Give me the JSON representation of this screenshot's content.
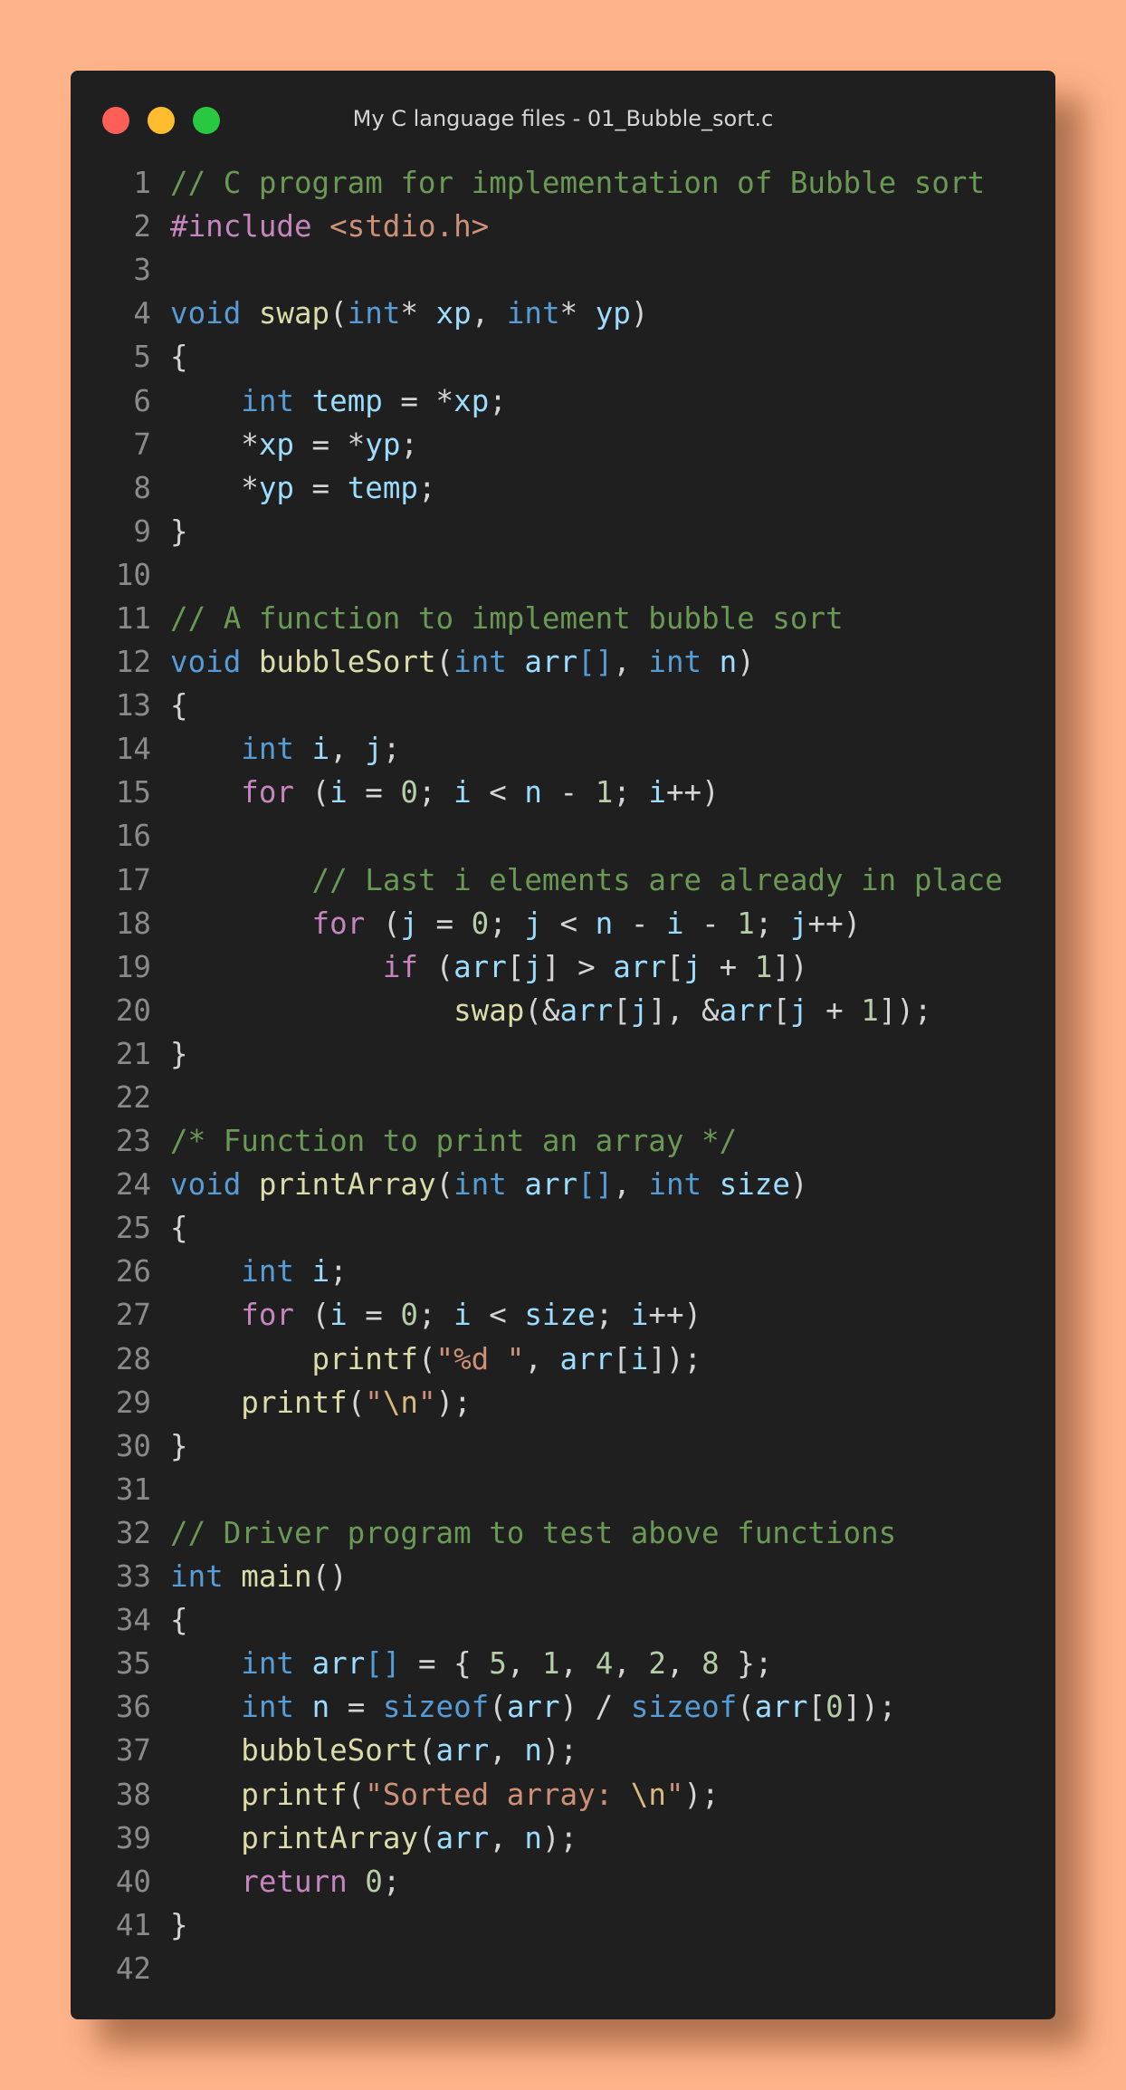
{
  "window": {
    "title": "My C language files - 01_Bubble_sort.c",
    "background": "#1f1f1f",
    "page_background": "#ffb38a"
  },
  "traffic_lights": [
    {
      "name": "close",
      "color": "#ff5f57"
    },
    {
      "name": "minimize",
      "color": "#febc2e"
    },
    {
      "name": "maximize",
      "color": "#28c840"
    }
  ],
  "code_lines": [
    {
      "n": "1",
      "tokens": [
        [
          "comment",
          "// C program for implementation of Bubble sort"
        ]
      ]
    },
    {
      "n": "2",
      "tokens": [
        [
          "control",
          "#include "
        ],
        [
          "string",
          "<stdio.h>"
        ]
      ]
    },
    {
      "n": "3",
      "tokens": []
    },
    {
      "n": "4",
      "tokens": [
        [
          "keyword",
          "void"
        ],
        [
          "punct",
          " "
        ],
        [
          "function",
          "swap"
        ],
        [
          "punct",
          "("
        ],
        [
          "keyword",
          "int"
        ],
        [
          "punct",
          "* "
        ],
        [
          "variable",
          "xp"
        ],
        [
          "punct",
          ", "
        ],
        [
          "keyword",
          "int"
        ],
        [
          "punct",
          "* "
        ],
        [
          "variable",
          "yp"
        ],
        [
          "punct",
          ")"
        ]
      ]
    },
    {
      "n": "5",
      "tokens": [
        [
          "punct",
          "{"
        ]
      ]
    },
    {
      "n": "6",
      "tokens": [
        [
          "punct",
          "    "
        ],
        [
          "keyword",
          "int"
        ],
        [
          "punct",
          " "
        ],
        [
          "variable",
          "temp"
        ],
        [
          "punct",
          " = *"
        ],
        [
          "variable",
          "xp"
        ],
        [
          "punct",
          ";"
        ]
      ]
    },
    {
      "n": "7",
      "tokens": [
        [
          "punct",
          "    *"
        ],
        [
          "variable",
          "xp"
        ],
        [
          "punct",
          " = *"
        ],
        [
          "variable",
          "yp"
        ],
        [
          "punct",
          ";"
        ]
      ]
    },
    {
      "n": "8",
      "tokens": [
        [
          "punct",
          "    *"
        ],
        [
          "variable",
          "yp"
        ],
        [
          "punct",
          " = "
        ],
        [
          "variable",
          "temp"
        ],
        [
          "punct",
          ";"
        ]
      ]
    },
    {
      "n": "9",
      "tokens": [
        [
          "punct",
          "}"
        ]
      ]
    },
    {
      "n": "10",
      "tokens": []
    },
    {
      "n": "11",
      "tokens": [
        [
          "comment",
          "// A function to implement bubble sort"
        ]
      ]
    },
    {
      "n": "12",
      "tokens": [
        [
          "keyword",
          "void"
        ],
        [
          "punct",
          " "
        ],
        [
          "function",
          "bubbleSort"
        ],
        [
          "punct",
          "("
        ],
        [
          "keyword",
          "int"
        ],
        [
          "punct",
          " "
        ],
        [
          "variable",
          "arr"
        ],
        [
          "bracket",
          "[]"
        ],
        [
          "punct",
          ", "
        ],
        [
          "keyword",
          "int"
        ],
        [
          "punct",
          " "
        ],
        [
          "variable",
          "n"
        ],
        [
          "punct",
          ")"
        ]
      ]
    },
    {
      "n": "13",
      "tokens": [
        [
          "punct",
          "{"
        ]
      ]
    },
    {
      "n": "14",
      "tokens": [
        [
          "punct",
          "    "
        ],
        [
          "keyword",
          "int"
        ],
        [
          "punct",
          " "
        ],
        [
          "variable",
          "i"
        ],
        [
          "punct",
          ", "
        ],
        [
          "variable",
          "j"
        ],
        [
          "punct",
          ";"
        ]
      ]
    },
    {
      "n": "15",
      "tokens": [
        [
          "punct",
          "    "
        ],
        [
          "control",
          "for"
        ],
        [
          "punct",
          " ("
        ],
        [
          "variable",
          "i"
        ],
        [
          "punct",
          " = "
        ],
        [
          "number",
          "0"
        ],
        [
          "punct",
          "; "
        ],
        [
          "variable",
          "i"
        ],
        [
          "punct",
          " < "
        ],
        [
          "variable",
          "n"
        ],
        [
          "punct",
          " - "
        ],
        [
          "number",
          "1"
        ],
        [
          "punct",
          "; "
        ],
        [
          "variable",
          "i"
        ],
        [
          "punct",
          "++)"
        ]
      ]
    },
    {
      "n": "16",
      "tokens": []
    },
    {
      "n": "17",
      "tokens": [
        [
          "punct",
          "        "
        ],
        [
          "comment",
          "// Last i elements are already in place"
        ]
      ]
    },
    {
      "n": "18",
      "tokens": [
        [
          "punct",
          "        "
        ],
        [
          "control",
          "for"
        ],
        [
          "punct",
          " ("
        ],
        [
          "variable",
          "j"
        ],
        [
          "punct",
          " = "
        ],
        [
          "number",
          "0"
        ],
        [
          "punct",
          "; "
        ],
        [
          "variable",
          "j"
        ],
        [
          "punct",
          " < "
        ],
        [
          "variable",
          "n"
        ],
        [
          "punct",
          " - "
        ],
        [
          "variable",
          "i"
        ],
        [
          "punct",
          " - "
        ],
        [
          "number",
          "1"
        ],
        [
          "punct",
          "; "
        ],
        [
          "variable",
          "j"
        ],
        [
          "punct",
          "++)"
        ]
      ]
    },
    {
      "n": "19",
      "tokens": [
        [
          "punct",
          "            "
        ],
        [
          "control",
          "if"
        ],
        [
          "punct",
          " ("
        ],
        [
          "variable",
          "arr"
        ],
        [
          "punct",
          "["
        ],
        [
          "variable",
          "j"
        ],
        [
          "punct",
          "] > "
        ],
        [
          "variable",
          "arr"
        ],
        [
          "punct",
          "["
        ],
        [
          "variable",
          "j"
        ],
        [
          "punct",
          " + "
        ],
        [
          "number",
          "1"
        ],
        [
          "punct",
          "])"
        ]
      ]
    },
    {
      "n": "20",
      "tokens": [
        [
          "punct",
          "                "
        ],
        [
          "function",
          "swap"
        ],
        [
          "punct",
          "(&"
        ],
        [
          "variable",
          "arr"
        ],
        [
          "punct",
          "["
        ],
        [
          "variable",
          "j"
        ],
        [
          "punct",
          "], &"
        ],
        [
          "variable",
          "arr"
        ],
        [
          "punct",
          "["
        ],
        [
          "variable",
          "j"
        ],
        [
          "punct",
          " + "
        ],
        [
          "number",
          "1"
        ],
        [
          "punct",
          "]);"
        ]
      ]
    },
    {
      "n": "21",
      "tokens": [
        [
          "punct",
          "}"
        ]
      ]
    },
    {
      "n": "22",
      "tokens": []
    },
    {
      "n": "23",
      "tokens": [
        [
          "comment",
          "/* Function to print an array */"
        ]
      ]
    },
    {
      "n": "24",
      "tokens": [
        [
          "keyword",
          "void"
        ],
        [
          "punct",
          " "
        ],
        [
          "function",
          "printArray"
        ],
        [
          "punct",
          "("
        ],
        [
          "keyword",
          "int"
        ],
        [
          "punct",
          " "
        ],
        [
          "variable",
          "arr"
        ],
        [
          "bracket",
          "[]"
        ],
        [
          "punct",
          ", "
        ],
        [
          "keyword",
          "int"
        ],
        [
          "punct",
          " "
        ],
        [
          "variable",
          "size"
        ],
        [
          "punct",
          ")"
        ]
      ]
    },
    {
      "n": "25",
      "tokens": [
        [
          "punct",
          "{"
        ]
      ]
    },
    {
      "n": "26",
      "tokens": [
        [
          "punct",
          "    "
        ],
        [
          "keyword",
          "int"
        ],
        [
          "punct",
          " "
        ],
        [
          "variable",
          "i"
        ],
        [
          "punct",
          ";"
        ]
      ]
    },
    {
      "n": "27",
      "tokens": [
        [
          "punct",
          "    "
        ],
        [
          "control",
          "for"
        ],
        [
          "punct",
          " ("
        ],
        [
          "variable",
          "i"
        ],
        [
          "punct",
          " = "
        ],
        [
          "number",
          "0"
        ],
        [
          "punct",
          "; "
        ],
        [
          "variable",
          "i"
        ],
        [
          "punct",
          " < "
        ],
        [
          "variable",
          "size"
        ],
        [
          "punct",
          "; "
        ],
        [
          "variable",
          "i"
        ],
        [
          "punct",
          "++)"
        ]
      ]
    },
    {
      "n": "28",
      "tokens": [
        [
          "punct",
          "        "
        ],
        [
          "function",
          "printf"
        ],
        [
          "punct",
          "("
        ],
        [
          "string",
          "\"%d \""
        ],
        [
          "punct",
          ", "
        ],
        [
          "variable",
          "arr"
        ],
        [
          "punct",
          "["
        ],
        [
          "variable",
          "i"
        ],
        [
          "punct",
          "]);"
        ]
      ]
    },
    {
      "n": "29",
      "tokens": [
        [
          "punct",
          "    "
        ],
        [
          "function",
          "printf"
        ],
        [
          "punct",
          "("
        ],
        [
          "string",
          "\""
        ],
        [
          "escape",
          "\\n"
        ],
        [
          "string",
          "\""
        ],
        [
          "punct",
          ");"
        ]
      ]
    },
    {
      "n": "30",
      "tokens": [
        [
          "punct",
          "}"
        ]
      ]
    },
    {
      "n": "31",
      "tokens": []
    },
    {
      "n": "32",
      "tokens": [
        [
          "comment",
          "// Driver program to test above functions"
        ]
      ]
    },
    {
      "n": "33",
      "tokens": [
        [
          "keyword",
          "int"
        ],
        [
          "punct",
          " "
        ],
        [
          "function",
          "main"
        ],
        [
          "punct",
          "()"
        ]
      ]
    },
    {
      "n": "34",
      "tokens": [
        [
          "punct",
          "{"
        ]
      ]
    },
    {
      "n": "35",
      "tokens": [
        [
          "punct",
          "    "
        ],
        [
          "keyword",
          "int"
        ],
        [
          "punct",
          " "
        ],
        [
          "variable",
          "arr"
        ],
        [
          "bracket",
          "[]"
        ],
        [
          "punct",
          " = { "
        ],
        [
          "number",
          "5"
        ],
        [
          "punct",
          ", "
        ],
        [
          "number",
          "1"
        ],
        [
          "punct",
          ", "
        ],
        [
          "number",
          "4"
        ],
        [
          "punct",
          ", "
        ],
        [
          "number",
          "2"
        ],
        [
          "punct",
          ", "
        ],
        [
          "number",
          "8"
        ],
        [
          "punct",
          " };"
        ]
      ]
    },
    {
      "n": "36",
      "tokens": [
        [
          "punct",
          "    "
        ],
        [
          "keyword",
          "int"
        ],
        [
          "punct",
          " "
        ],
        [
          "variable",
          "n"
        ],
        [
          "punct",
          " = "
        ],
        [
          "keyword",
          "sizeof"
        ],
        [
          "punct",
          "("
        ],
        [
          "variable",
          "arr"
        ],
        [
          "punct",
          ") / "
        ],
        [
          "keyword",
          "sizeof"
        ],
        [
          "punct",
          "("
        ],
        [
          "variable",
          "arr"
        ],
        [
          "punct",
          "["
        ],
        [
          "number",
          "0"
        ],
        [
          "punct",
          "]);"
        ]
      ]
    },
    {
      "n": "37",
      "tokens": [
        [
          "punct",
          "    "
        ],
        [
          "function",
          "bubbleSort"
        ],
        [
          "punct",
          "("
        ],
        [
          "variable",
          "arr"
        ],
        [
          "punct",
          ", "
        ],
        [
          "variable",
          "n"
        ],
        [
          "punct",
          ");"
        ]
      ]
    },
    {
      "n": "38",
      "tokens": [
        [
          "punct",
          "    "
        ],
        [
          "function",
          "printf"
        ],
        [
          "punct",
          "("
        ],
        [
          "string",
          "\"Sorted array: "
        ],
        [
          "escape",
          "\\n"
        ],
        [
          "string",
          "\""
        ],
        [
          "punct",
          ");"
        ]
      ]
    },
    {
      "n": "39",
      "tokens": [
        [
          "punct",
          "    "
        ],
        [
          "function",
          "printArray"
        ],
        [
          "punct",
          "("
        ],
        [
          "variable",
          "arr"
        ],
        [
          "punct",
          ", "
        ],
        [
          "variable",
          "n"
        ],
        [
          "punct",
          ");"
        ]
      ]
    },
    {
      "n": "40",
      "tokens": [
        [
          "punct",
          "    "
        ],
        [
          "control",
          "return"
        ],
        [
          "punct",
          " "
        ],
        [
          "number",
          "0"
        ],
        [
          "punct",
          ";"
        ]
      ]
    },
    {
      "n": "41",
      "tokens": [
        [
          "punct",
          "}"
        ]
      ]
    },
    {
      "n": "42",
      "tokens": []
    }
  ]
}
